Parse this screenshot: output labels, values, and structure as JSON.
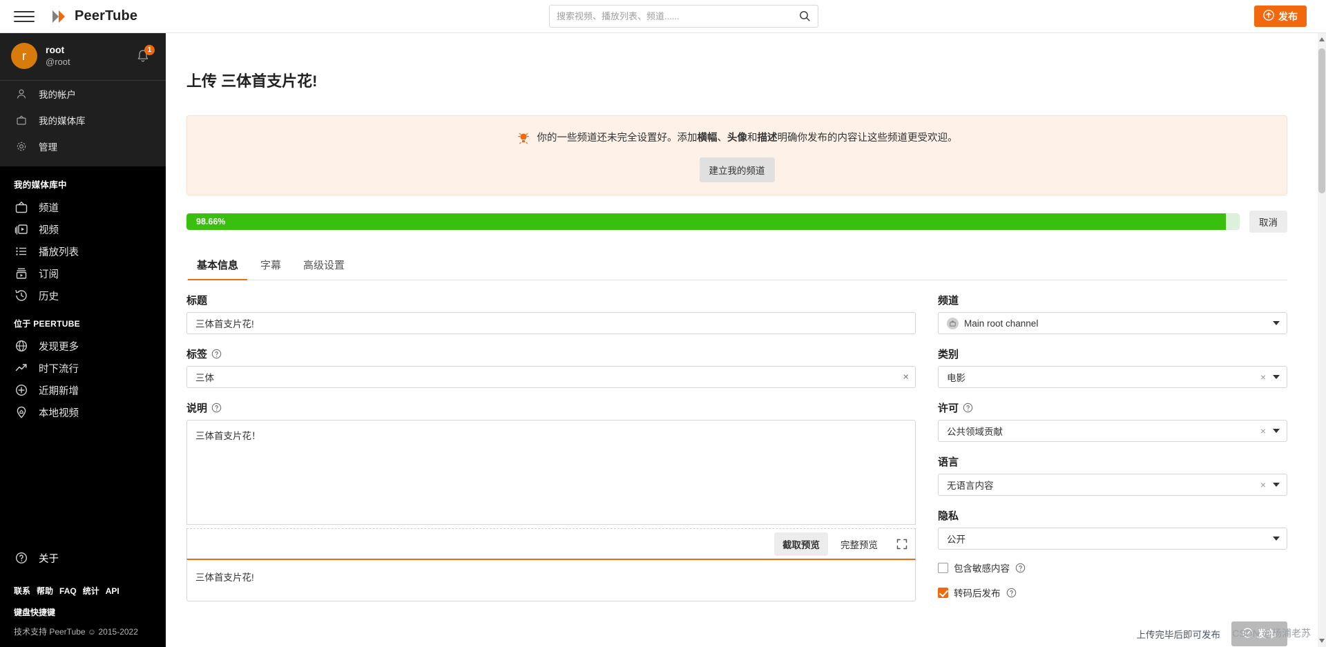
{
  "topbar": {
    "menu_icon": "hamburger-icon",
    "brand": "PeerTube",
    "search_placeholder": "搜索视频、播放列表、频道......",
    "search_value": "",
    "search_icon": "search-icon",
    "publish_label": "发布",
    "publish_icon": "upload-icon"
  },
  "sidebar": {
    "account": {
      "avatar_letter": "r",
      "display_name": "root",
      "handle": "@root",
      "bell_icon": "bell-icon",
      "notification_count": "1"
    },
    "account_menu": [
      {
        "label": "我的帐户",
        "icon": "user-icon"
      },
      {
        "label": "我的媒体库",
        "icon": "tv-icon"
      },
      {
        "label": "管理",
        "icon": "gear-icon"
      }
    ],
    "library_section": "我的媒体库中",
    "library_items": [
      {
        "label": "频道",
        "icon": "tv-icon"
      },
      {
        "label": "视频",
        "icon": "video-icon"
      },
      {
        "label": "播放列表",
        "icon": "list-icon"
      },
      {
        "label": "订阅",
        "icon": "subscriptions-icon"
      },
      {
        "label": "历史",
        "icon": "history-icon"
      }
    ],
    "peertube_section": "位于 PEERTUBE",
    "peertube_items": [
      {
        "label": "发现更多",
        "icon": "globe-icon"
      },
      {
        "label": "时下流行",
        "icon": "trending-icon"
      },
      {
        "label": "近期新增",
        "icon": "plus-circle-icon"
      },
      {
        "label": "本地视频",
        "icon": "pin-icon"
      }
    ],
    "about": {
      "label": "关于",
      "icon": "question-circle-icon"
    },
    "footer_links": [
      "联系",
      "帮助",
      "FAQ",
      "统计",
      "API"
    ],
    "footer_shortcut": "键盘快捷键",
    "footer_credit": "技术支持 PeerTube ☺ 2015-2022"
  },
  "main": {
    "page_title": "上传 三体首支片花!",
    "alert": {
      "icon": "bulb-icon",
      "text_parts": [
        {
          "text": "你的一些频道还未完全设置好。添加",
          "bold": false
        },
        {
          "text": "横幅",
          "bold": true
        },
        {
          "text": "、",
          "bold": false
        },
        {
          "text": "头像",
          "bold": true
        },
        {
          "text": "和",
          "bold": false
        },
        {
          "text": "描述",
          "bold": true
        },
        {
          "text": "明确你发布的内容让这些频道更受欢迎。",
          "bold": false
        }
      ],
      "button_label": "建立我的频道"
    },
    "progress": {
      "percent_label": "98.66%",
      "percent_value": 98.66,
      "bar_color": "#39C00F",
      "track_color": "#DCF0DC",
      "cancel_label": "取消"
    },
    "tabs": [
      {
        "label": "基本信息",
        "active": true
      },
      {
        "label": "字幕",
        "active": false
      },
      {
        "label": "高级设置",
        "active": false
      }
    ],
    "form": {
      "title_label": "标题",
      "title_value": "三体首支片花!",
      "tags_label": "标签",
      "tags_value": "三体",
      "tags_clear_icon": "close-icon",
      "desc_label": "说明",
      "desc_value": "三体首支片花！",
      "desc_preview_value": "三体首支片花!",
      "preview_crop_label": "截取预览",
      "preview_full_label": "完整预览",
      "expand_icon": "fullscreen-icon",
      "channel_label": "频道",
      "channel_value": "Main root channel",
      "channel_icon": "tv-icon",
      "category_label": "类别",
      "category_value": "电影",
      "licence_label": "许可",
      "licence_value": "公共领域贡献",
      "language_label": "语言",
      "language_value": "无语言内容",
      "privacy_label": "隐私",
      "privacy_value": "公开",
      "nsfw_label": "包含敏感内容",
      "nsfw_checked": false,
      "wait_transcoding_label": "转码后发布",
      "wait_transcoding_checked": true,
      "publish_hint": "上传完毕后即可发布",
      "publish_label": "发布",
      "publish_icon": "check-circle-icon"
    }
  },
  "watermark": "CSDN @杨浦老苏",
  "colors": {
    "accent": "#F1680D",
    "progress_green": "#39C00F",
    "sidebar_bg": "#000000",
    "account_bg": "#1f1f1f",
    "alert_bg": "#FDF1E8"
  }
}
